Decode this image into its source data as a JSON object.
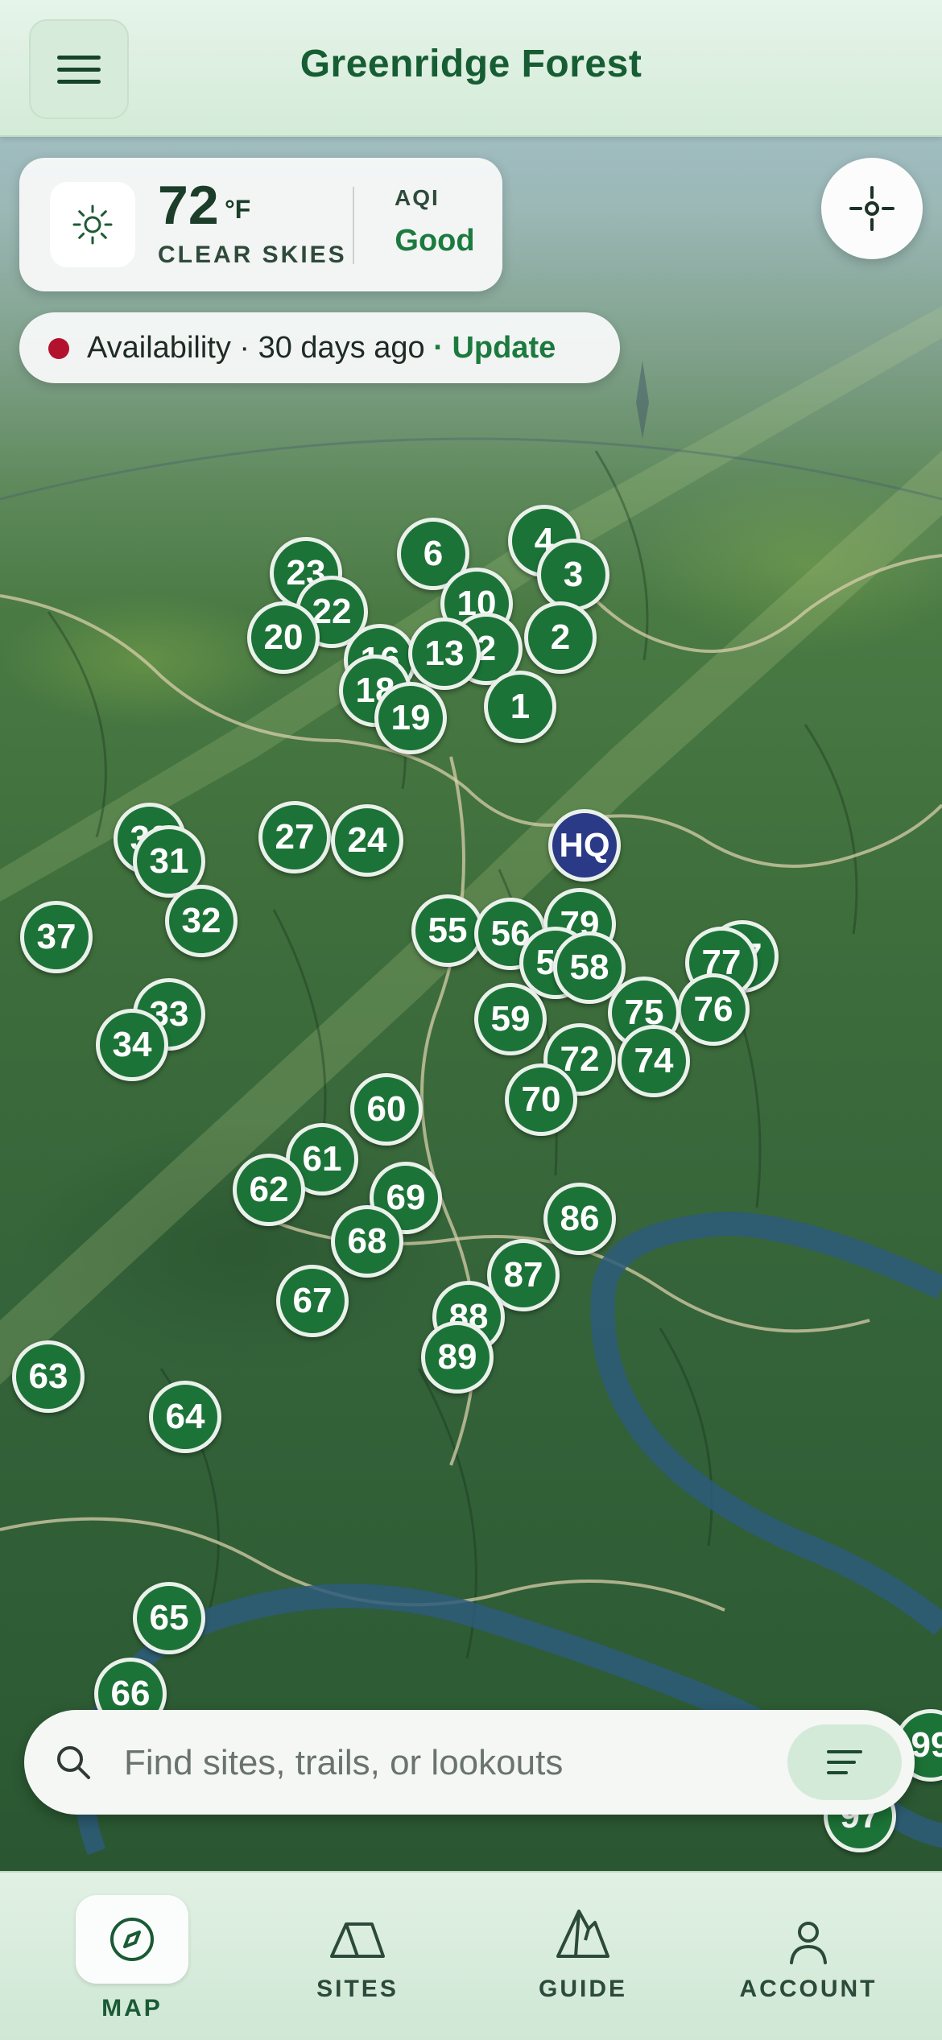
{
  "header": {
    "title": "Greenridge Forest"
  },
  "weather": {
    "temperature": "72",
    "unit": "°F",
    "condition": "CLEAR SKIES",
    "aqi_label": "AQI",
    "aqi_value": "Good"
  },
  "availability": {
    "text": "Availability · 30 days ago",
    "separator": " · ",
    "action": "Update"
  },
  "markers": [
    "23",
    "22",
    "20",
    "6",
    "4",
    "3",
    "10",
    "2",
    "13",
    "16",
    "18",
    "19",
    "1",
    "HQ",
    "31",
    "30",
    "27",
    "24",
    "37",
    "32",
    "33",
    "34",
    "55",
    "56",
    "79",
    "57",
    "58",
    "77",
    "76",
    "59",
    "75",
    "72",
    "74",
    "70",
    "60",
    "61",
    "62",
    "69",
    "68",
    "86",
    "67",
    "87",
    "88",
    "89",
    "63",
    "64",
    "65",
    "66",
    "99",
    "97"
  ],
  "search": {
    "placeholder": "Find sites, trails, or lookouts"
  },
  "tabs": [
    {
      "label": "MAP",
      "icon": "compass-icon",
      "active": true
    },
    {
      "label": "SITES",
      "icon": "tent-icon",
      "active": false
    },
    {
      "label": "GUIDE",
      "icon": "mountain-icon",
      "active": false
    },
    {
      "label": "ACCOUNT",
      "icon": "person-icon",
      "active": false
    }
  ],
  "colors": {
    "brand": "#165d33",
    "marker": "#1c7337",
    "hq": "#2b3a87",
    "alert": "#b3122e"
  }
}
